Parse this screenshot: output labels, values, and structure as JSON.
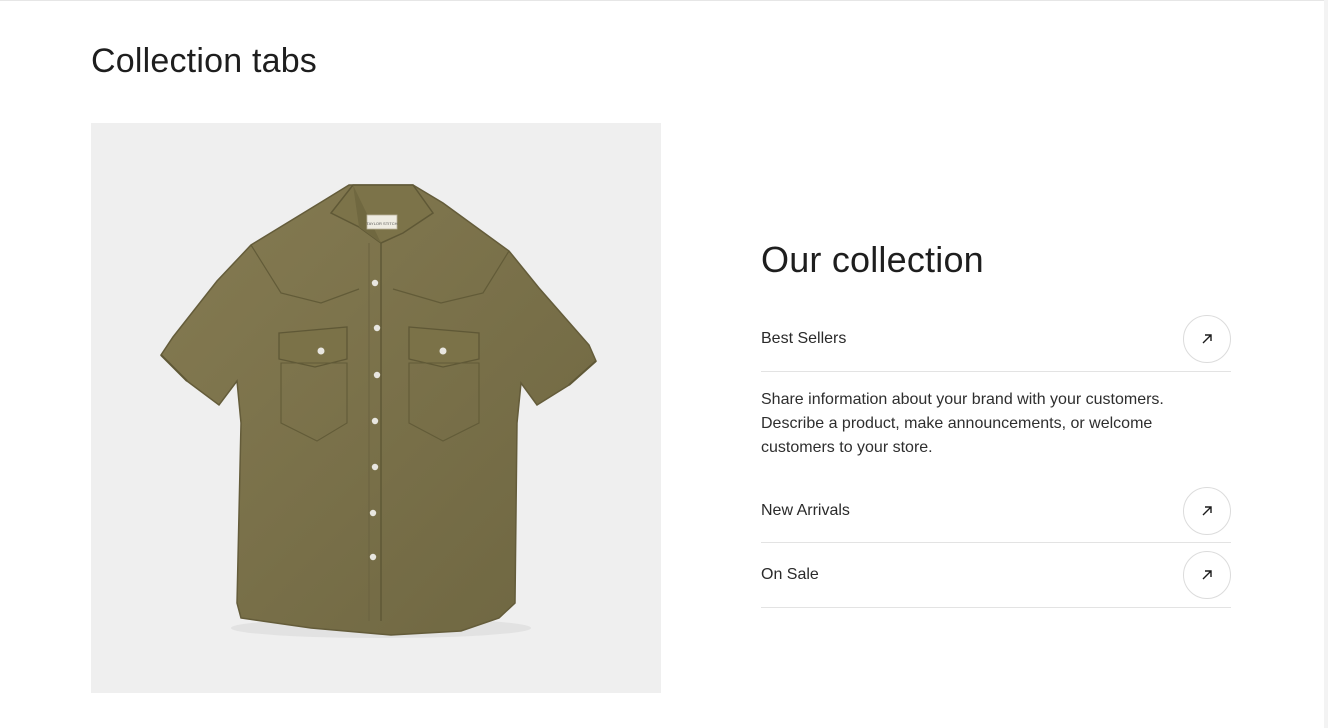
{
  "section": {
    "title": "Collection tabs"
  },
  "media": {
    "image_alt": "Olive green short-sleeve western shirt",
    "label_text": "TAYLOR STITCH"
  },
  "collection": {
    "title": "Our collection",
    "tabs": [
      {
        "label": "Best Sellers",
        "expanded": true,
        "icon": "arrow-up-right-icon"
      },
      {
        "label": "New Arrivals",
        "expanded": false,
        "icon": "arrow-up-right-icon"
      },
      {
        "label": "On Sale",
        "expanded": false,
        "icon": "arrow-up-right-icon"
      }
    ],
    "description": "Share information about your brand with your customers. Describe a product, make announcements, or welcome customers to your store."
  },
  "colors": {
    "image_background": "#efefef",
    "shirt": "#7a7148",
    "divider": "#e3e3e3"
  }
}
